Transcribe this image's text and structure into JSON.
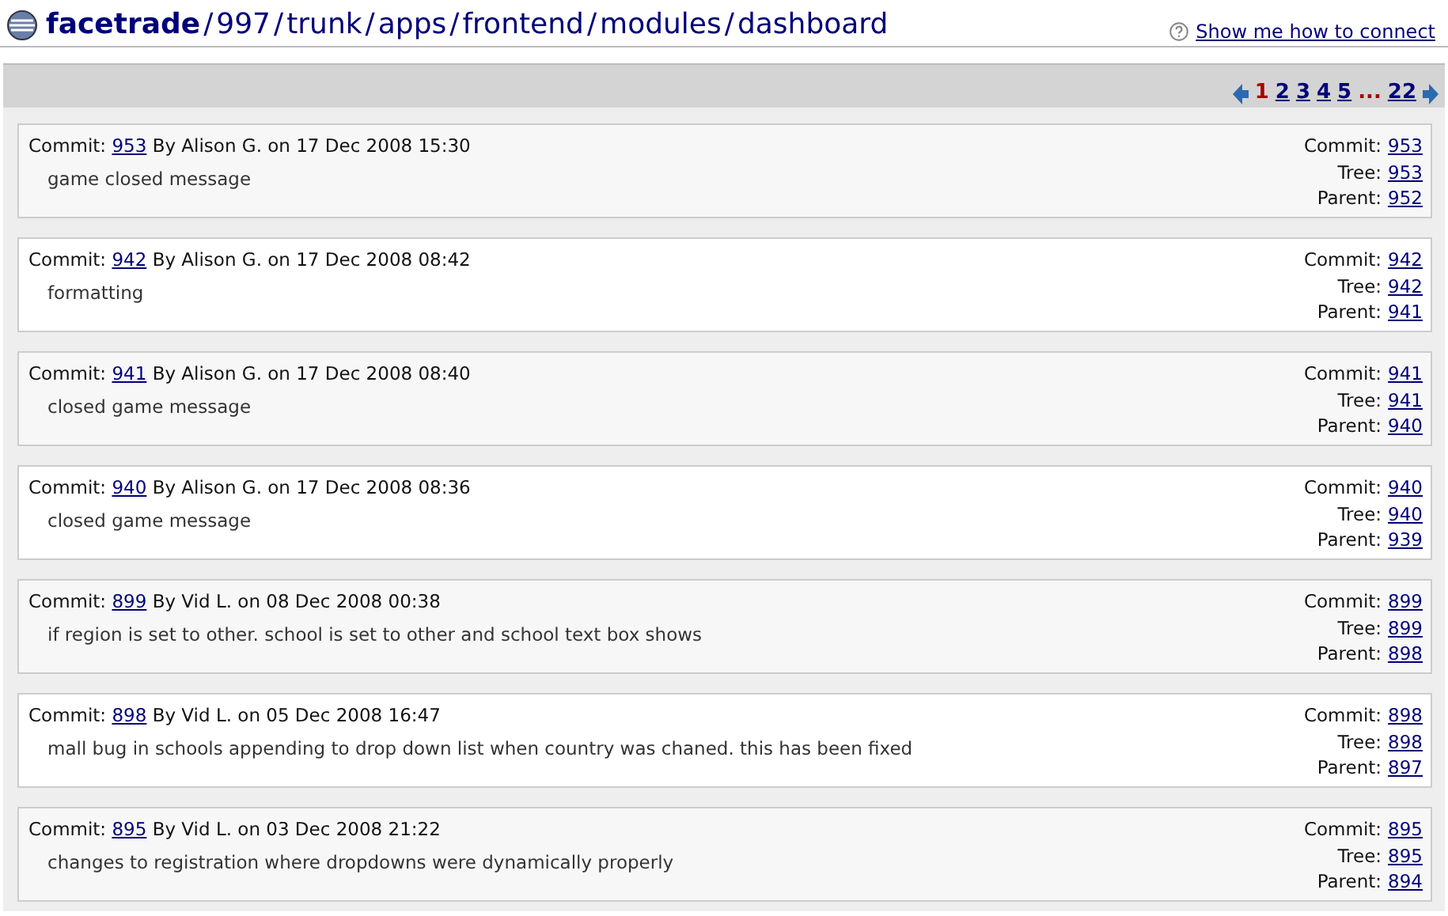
{
  "breadcrumb": {
    "separator": "/",
    "segments": [
      "facetrade",
      "997",
      "trunk",
      "apps",
      "frontend",
      "modules",
      "dashboard"
    ]
  },
  "help_link": "Show me how to connect",
  "pagination": {
    "pages": [
      {
        "label": "1",
        "selected": true
      },
      {
        "label": "2",
        "selected": false
      },
      {
        "label": "3",
        "selected": false
      },
      {
        "label": "4",
        "selected": false
      },
      {
        "label": "5",
        "selected": false
      }
    ],
    "ellipsis": "...",
    "last_page": {
      "label": "22",
      "selected": false
    }
  },
  "commits": [
    {
      "label": "Commit:",
      "id": "953",
      "byline": "By Alison G. on 17 Dec 2008 15:30",
      "message": "game closed message",
      "refs": [
        {
          "label": "Commit:",
          "value": "953"
        },
        {
          "label": "Tree:",
          "value": "953"
        },
        {
          "label": "Parent:",
          "value": "952"
        }
      ]
    },
    {
      "label": "Commit:",
      "id": "942",
      "byline": "By Alison G. on 17 Dec 2008 08:42",
      "message": "formatting",
      "refs": [
        {
          "label": "Commit:",
          "value": "942"
        },
        {
          "label": "Tree:",
          "value": "942"
        },
        {
          "label": "Parent:",
          "value": "941"
        }
      ]
    },
    {
      "label": "Commit:",
      "id": "941",
      "byline": "By Alison G. on 17 Dec 2008 08:40",
      "message": "closed game message",
      "refs": [
        {
          "label": "Commit:",
          "value": "941"
        },
        {
          "label": "Tree:",
          "value": "941"
        },
        {
          "label": "Parent:",
          "value": "940"
        }
      ]
    },
    {
      "label": "Commit:",
      "id": "940",
      "byline": "By Alison G. on 17 Dec 2008 08:36",
      "message": "closed game message",
      "refs": [
        {
          "label": "Commit:",
          "value": "940"
        },
        {
          "label": "Tree:",
          "value": "940"
        },
        {
          "label": "Parent:",
          "value": "939"
        }
      ]
    },
    {
      "label": "Commit:",
      "id": "899",
      "byline": "By Vid L. on 08 Dec 2008 00:38",
      "message": "if region is set to other. school is set to other and school text box shows",
      "refs": [
        {
          "label": "Commit:",
          "value": "899"
        },
        {
          "label": "Tree:",
          "value": "899"
        },
        {
          "label": "Parent:",
          "value": "898"
        }
      ]
    },
    {
      "label": "Commit:",
      "id": "898",
      "byline": "By Vid L. on 05 Dec 2008 16:47",
      "message": "mall bug in schools appending to drop down list when country was chaned. this has been fixed",
      "refs": [
        {
          "label": "Commit:",
          "value": "898"
        },
        {
          "label": "Tree:",
          "value": "898"
        },
        {
          "label": "Parent:",
          "value": "897"
        }
      ]
    },
    {
      "label": "Commit:",
      "id": "895",
      "byline": "By Vid L. on 03 Dec 2008 21:22",
      "message": "changes to registration where dropdowns were dynamically properly",
      "refs": [
        {
          "label": "Commit:",
          "value": "895"
        },
        {
          "label": "Tree:",
          "value": "895"
        },
        {
          "label": "Parent:",
          "value": "894"
        }
      ]
    }
  ]
}
